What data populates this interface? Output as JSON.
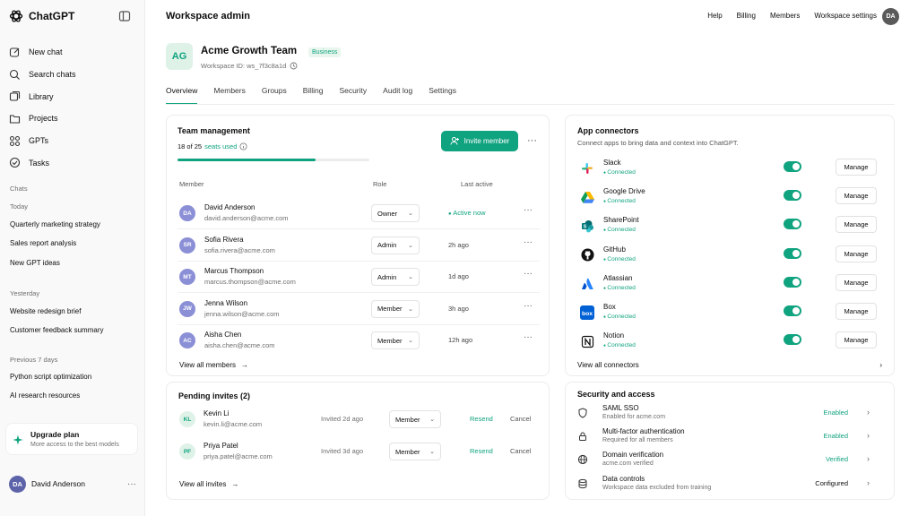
{
  "sidebar": {
    "brand": "ChatGPT",
    "nav": [
      {
        "label": "New chat",
        "icon": "edit-icon"
      },
      {
        "label": "Search chats",
        "icon": "search-icon"
      },
      {
        "label": "Library",
        "icon": "library-icon"
      },
      {
        "label": "Projects",
        "icon": "folder-icon"
      },
      {
        "label": "GPTs",
        "icon": "grid-icon"
      },
      {
        "label": "Tasks",
        "icon": "tasks-icon"
      }
    ],
    "chats_label": "Chats",
    "today_label": "Today",
    "today": [
      "Quarterly marketing strategy",
      "Sales report analysis",
      "New GPT ideas"
    ],
    "yesterday_label": "Yesterday",
    "yesterday": [
      "Website redesign brief",
      "Customer feedback summary"
    ],
    "prev7_label": "Previous 7 days",
    "prev7": [
      "Python script optimization",
      "AI research resources"
    ],
    "upgrade": {
      "title": "Upgrade plan",
      "subtitle": "More access to the best models"
    },
    "user": {
      "initials": "DA",
      "name": "David Anderson"
    }
  },
  "topbar": {
    "title": "Workspace admin",
    "links": [
      "Help",
      "Billing",
      "Members",
      "Workspace settings"
    ],
    "avatar": "DA"
  },
  "header": {
    "initials": "AG",
    "team_name": "Acme Growth Team",
    "badge": "Business",
    "workspace_id": "Workspace ID: ws_7f3c8a1d"
  },
  "tabs": [
    "Overview",
    "Members",
    "Groups",
    "Billing",
    "Security",
    "Audit log",
    "Settings"
  ],
  "team": {
    "title": "Team management",
    "seats_count": "18 of 25",
    "seats_link": "seats used",
    "seats_fraction": 0.72,
    "invite_label": "Invite member",
    "col_member": "Member",
    "col_role": "Role",
    "col_last": "Last active",
    "members": [
      {
        "initials": "DA",
        "name": "David Anderson",
        "email": "david.anderson@acme.com",
        "role": "Owner",
        "last": "Active now",
        "active": true
      },
      {
        "initials": "SR",
        "name": "Sofia Rivera",
        "email": "sofia.rivera@acme.com",
        "role": "Admin",
        "last": "2h ago",
        "active": false
      },
      {
        "initials": "MT",
        "name": "Marcus Thompson",
        "email": "marcus.thompson@acme.com",
        "role": "Admin",
        "last": "1d ago",
        "active": false
      },
      {
        "initials": "JW",
        "name": "Jenna Wilson",
        "email": "jenna.wilson@acme.com",
        "role": "Member",
        "last": "3h ago",
        "active": false
      },
      {
        "initials": "AC",
        "name": "Aisha Chen",
        "email": "aisha.chen@acme.com",
        "role": "Member",
        "last": "12h ago",
        "active": false
      }
    ],
    "view_all": "View all members"
  },
  "invites": {
    "title": "Pending invites (2)",
    "items": [
      {
        "initials": "KL",
        "name": "Kevin Li",
        "email": "kevin.li@acme.com",
        "invited": "Invited 2d ago",
        "role": "Member",
        "resend": "Resend",
        "cancel": "Cancel"
      },
      {
        "initials": "PF",
        "name": "Priya Patel",
        "email": "priya.patel@acme.com",
        "invited": "Invited 3d ago",
        "role": "Member",
        "resend": "Resend",
        "cancel": "Cancel"
      }
    ],
    "view_all": "View all invites"
  },
  "connectors": {
    "title": "App connectors",
    "subtitle": "Connect apps to bring data and context into ChatGPT.",
    "items": [
      {
        "name": "Slack",
        "status": "Connected",
        "manage": "Manage",
        "icon": "slack-icon"
      },
      {
        "name": "Google Drive",
        "status": "Connected",
        "manage": "Manage",
        "icon": "google-drive-icon"
      },
      {
        "name": "SharePoint",
        "status": "Connected",
        "manage": "Manage",
        "icon": "sharepoint-icon"
      },
      {
        "name": "GitHub",
        "status": "Connected",
        "manage": "Manage",
        "icon": "github-icon"
      },
      {
        "name": "Atlassian",
        "status": "Connected",
        "manage": "Manage",
        "icon": "atlassian-icon"
      },
      {
        "name": "Box",
        "status": "Connected",
        "manage": "Manage",
        "icon": "box-icon"
      },
      {
        "name": "Notion",
        "status": "Connected",
        "manage": "Manage",
        "icon": "notion-icon"
      }
    ],
    "view_all": "View all connectors"
  },
  "security": {
    "title": "Security and access",
    "items": [
      {
        "name": "SAML SSO",
        "desc": "Enabled for acme.com",
        "status": "Enabled",
        "green": true,
        "icon": "shield-icon"
      },
      {
        "name": "Multi-factor authentication",
        "desc": "Required for all members",
        "status": "Enabled",
        "green": true,
        "icon": "lock-icon"
      },
      {
        "name": "Domain verification",
        "desc": "acme.com verified",
        "status": "Verified",
        "green": true,
        "icon": "globe-icon"
      },
      {
        "name": "Data controls",
        "desc": "Workspace data excluded from training",
        "status": "Configured",
        "green": false,
        "icon": "database-icon"
      }
    ]
  },
  "colors": {
    "accent": "#10a37f",
    "member_avatar": "#8b8fd6"
  }
}
